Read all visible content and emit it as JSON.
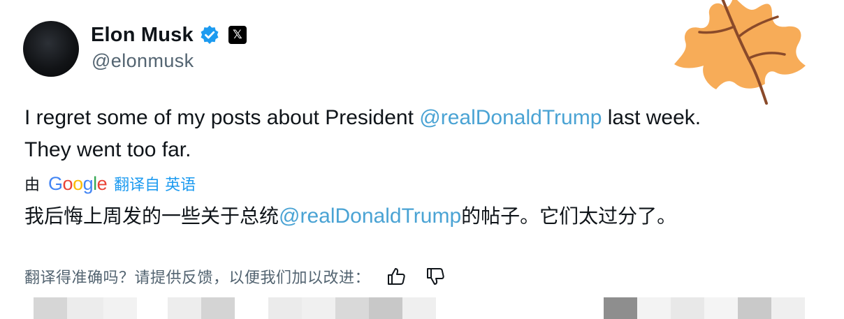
{
  "author": {
    "display_name": "Elon Musk",
    "handle": "@elonmusk",
    "verified_icon": "verified-badge-icon",
    "affiliation_icon": "x-logo-icon",
    "affiliation_glyph": "𝕏"
  },
  "post": {
    "text_line1_before": "I regret some of my posts about President ",
    "text_line1_mention": "@realDonaldTrump",
    "text_line1_after": " last week.",
    "text_line2": "They went too far."
  },
  "translation": {
    "by_label": "由",
    "provider_letters": [
      "G",
      "o",
      "o",
      "g",
      "l",
      "e"
    ],
    "translated_from_label": "翻译自 英语",
    "text_before": "我后悔上周发的一些关于总统",
    "text_mention": "@realDonaldTrump",
    "text_after": "的帖子。它们太过分了。",
    "feedback_prompt": "翻译得准确吗？请提供反馈，以便我们加以改进：",
    "thumbs_up_icon": "thumbs-up-icon",
    "thumbs_down_icon": "thumbs-down-icon"
  },
  "decoration": {
    "leaf_icon": "maple-leaf-icon"
  },
  "colors": {
    "mention": "#4aa3d4",
    "link": "#1d9bf0",
    "secondary_text": "#536471",
    "verified": "#1d9bf0",
    "leaf": "#f6a54a"
  }
}
